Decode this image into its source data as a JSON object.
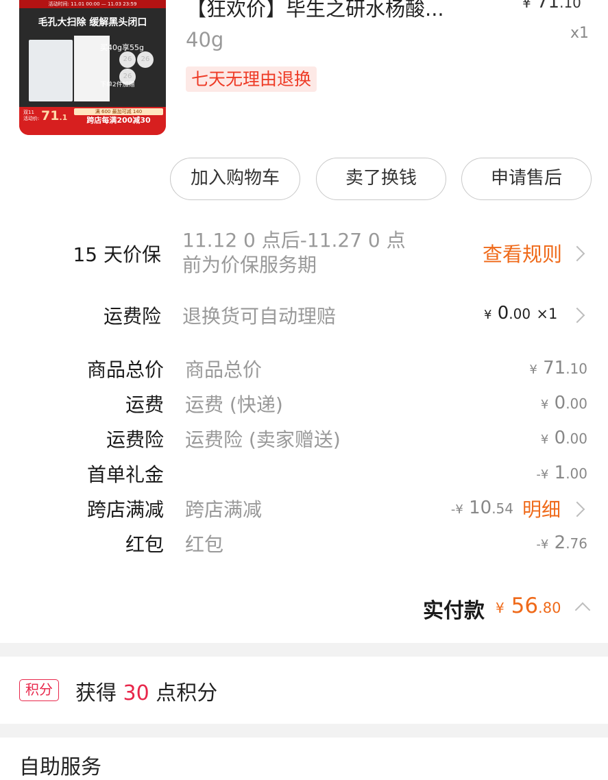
{
  "product": {
    "thumb": {
      "promo_strip": "活动时间: 11.01 00:00 — 11.03 23:59",
      "headline": "毛孔大扫除  缓解黑头闭口",
      "buy": "买40g享55g",
      "pad_number": "26",
      "gift": "下单2件加赠",
      "price_caption_1": "双11",
      "price_caption_2": "活动价:",
      "price_main": "71",
      "price_decimal": ".1",
      "full_reduction": "满 600 最加可减 140",
      "cross_store": "跨店每满200减30"
    },
    "title": "【狂欢价】毕生之研水杨酸...",
    "price_yen": "¥",
    "price_int": "71",
    "price_dec": ".10",
    "spec": "40g",
    "qty": "x1",
    "return_policy": "七天无理由退换"
  },
  "actions": {
    "add_to_cart": "加入购物车",
    "sell": "卖了换钱",
    "after_sale": "申请售后"
  },
  "price_protection": {
    "label": "15 天价保",
    "desc_line1": "11.12 0 点后-11.27 0 点",
    "desc_line2": "前为价保服务期",
    "link": "查看规则"
  },
  "shipping_insurance_service": {
    "label": "运费险",
    "desc": "退换货可自动理赔",
    "yen": "¥",
    "amount_int": "0",
    "amount_dec": ".00",
    "qty": "×1"
  },
  "price_breakdown": [
    {
      "label": "商品总价",
      "desc": "商品总价",
      "yen": "¥",
      "int": "71",
      "dec": ".10",
      "prefix": ""
    },
    {
      "label": "运费",
      "desc": "运费 (快递)",
      "yen": "¥",
      "int": "0",
      "dec": ".00",
      "prefix": ""
    },
    {
      "label": "运费险",
      "desc": "运费险 (卖家赠送)",
      "yen": "¥",
      "int": "0",
      "dec": ".00",
      "prefix": ""
    },
    {
      "label": "首单礼金",
      "desc": "",
      "yen": "¥",
      "int": "1",
      "dec": ".00",
      "prefix": "-"
    },
    {
      "label": "跨店满减",
      "desc": "跨店满减",
      "yen": "¥",
      "int": "10",
      "dec": ".54",
      "prefix": "-",
      "link": "明细"
    },
    {
      "label": "红包",
      "desc": "红包",
      "yen": "¥",
      "int": "2",
      "dec": ".76",
      "prefix": "-"
    }
  ],
  "total": {
    "label": "实付款",
    "yen": "¥",
    "int": "56",
    "dec": ".80"
  },
  "points": {
    "badge": "积分",
    "text_before": "获得 ",
    "number": "30",
    "text_after": " 点积分"
  },
  "next_section": {
    "title": "自助服务"
  },
  "colors": {
    "accent_orange": "#ef6a1a",
    "points_red": "#e8264a",
    "return_red": "#ee3b26"
  }
}
